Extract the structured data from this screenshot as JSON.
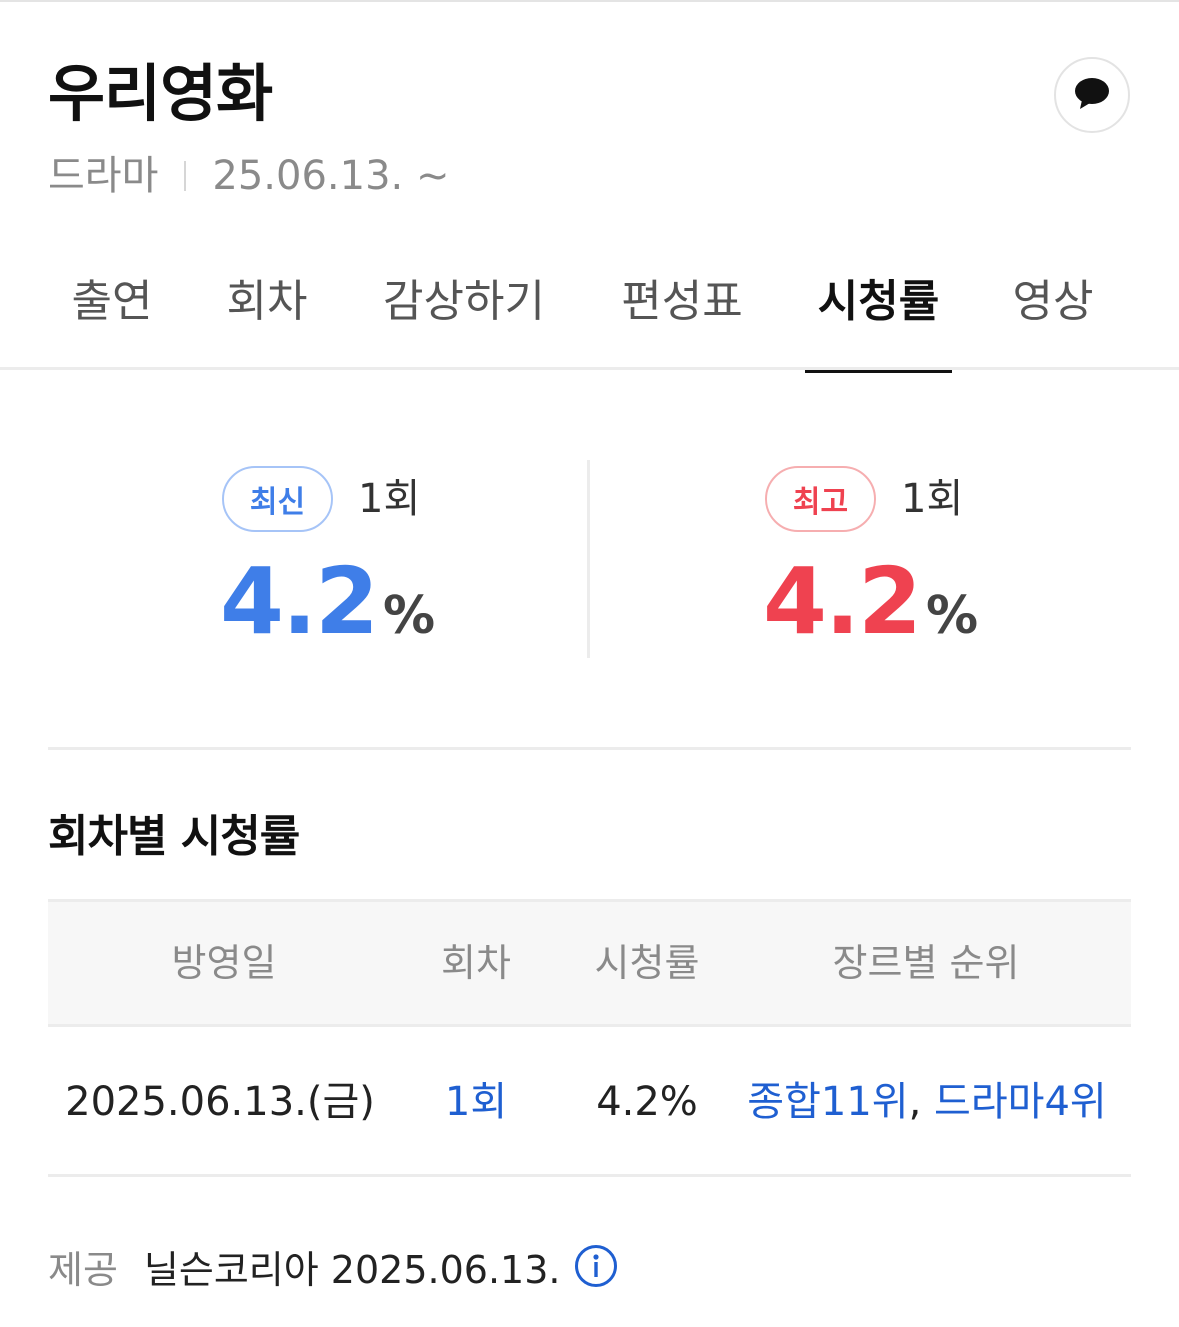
{
  "header": {
    "title": "우리영화",
    "genre": "드라마",
    "date_range": "25.06.13. ~"
  },
  "tabs": [
    {
      "label": "출연",
      "active": false
    },
    {
      "label": "회차",
      "active": false
    },
    {
      "label": "감상하기",
      "active": false
    },
    {
      "label": "편성표",
      "active": false
    },
    {
      "label": "시청률",
      "active": true
    },
    {
      "label": "영상",
      "active": false
    }
  ],
  "summary": {
    "latest": {
      "badge": "최신",
      "episode": "1회",
      "value": "4.2",
      "unit": "%"
    },
    "highest": {
      "badge": "최고",
      "episode": "1회",
      "value": "4.2",
      "unit": "%"
    }
  },
  "episode_ratings": {
    "title": "회차별 시청률",
    "columns": [
      "방영일",
      "회차",
      "시청률",
      "장르별 순위"
    ],
    "rows": [
      {
        "date": "2025.06.13.(금)",
        "episode": "1회",
        "rating": "4.2%",
        "rank_overall": "종합11위",
        "rank_separator": ",",
        "rank_genre": "드라마4위"
      }
    ]
  },
  "provider": {
    "label": "제공",
    "text": "닐슨코리아 2025.06.13."
  },
  "colors": {
    "accent_blue": "#3f7ee8",
    "accent_red": "#ef4250",
    "link_blue": "#1f5fd1"
  },
  "icons": {
    "talk": "speech-bubble-icon",
    "info": "info-circle-icon"
  }
}
